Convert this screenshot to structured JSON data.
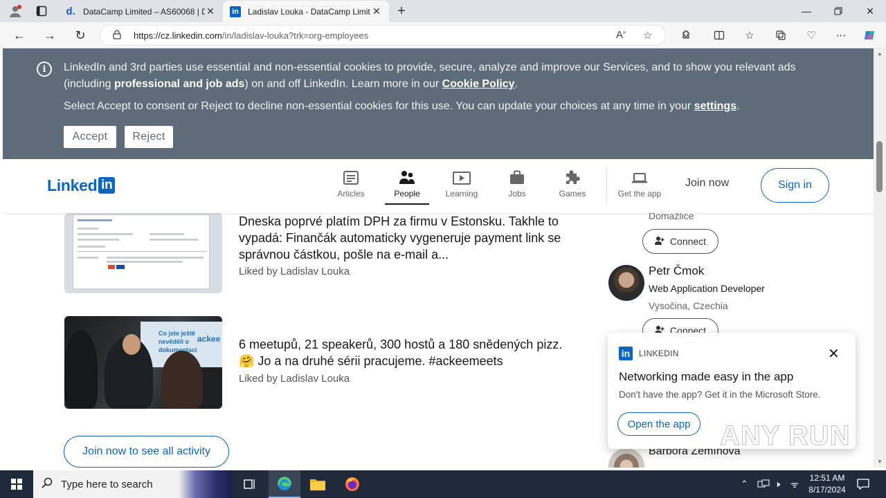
{
  "browser": {
    "tabs": [
      {
        "title": "DataCamp Limited – AS60068 | D",
        "favicon": "d."
      },
      {
        "title": "Ladislav Louka - DataCamp Limit",
        "favicon": "in"
      }
    ],
    "url_main": "https://cz.linkedin.com",
    "url_path": "/in/ladislav-louka?trk=org-employees"
  },
  "cookie_banner": {
    "line1_a": "LinkedIn and 3rd parties use essential and non-essential cookies to provide, secure, analyze and improve our Services, and to show you relevant ads (including ",
    "line1_bold": "professional and job ads",
    "line1_b": ") on and off LinkedIn. Learn more in our ",
    "cookie_policy": "Cookie Policy",
    "line1_c": ".",
    "line2_a": "Select Accept to consent or Reject to decline non-essential cookies for this use. You can update your choices at any time in your ",
    "settings": "settings",
    "line2_b": ".",
    "accept": "Accept",
    "reject": "Reject"
  },
  "nav": {
    "logo_text": "Linked",
    "logo_in": "in",
    "items": [
      {
        "label": "Articles"
      },
      {
        "label": "People"
      },
      {
        "label": "Learning"
      },
      {
        "label": "Jobs"
      },
      {
        "label": "Games"
      },
      {
        "label": "Get the app"
      }
    ],
    "join_now": "Join now",
    "sign_in": "Sign in"
  },
  "activity": [
    {
      "text": "Dneska poprvé platím DPH za firmu v Estonsku. Takhle to vypadá: Finančák automaticky vygeneruje payment link se správnou částkou, pošle na e-mail a...",
      "liked": "Liked by Ladislav Louka"
    },
    {
      "text": "6 meetupů, 21 speakerů, 300 hostů a 180 snědených pizz. 🤗 Jo a na druhé sérii pracujeme. #ackeemeets",
      "liked": "Liked by Ladislav Louka",
      "thumb_text_1": "Co jste ještě",
      "thumb_text_2": "nevěděli o",
      "thumb_text_3": "dokumentaci",
      "thumb_brand": "ackee"
    }
  ],
  "join_all": "Join now to see all activity",
  "people": {
    "p0_location": "Domažlice",
    "connect": "Connect",
    "p1_name": "Petr Čmok",
    "p1_title": "Web Application Developer",
    "p1_location": "Vysočina, Czechia",
    "p3_name": "Barbora Zemínová"
  },
  "app_popup": {
    "brand": "LINKEDIN",
    "heading": "Networking made easy in the app",
    "text": "Don't have the app? Get it in the Microsoft Store.",
    "button": "Open the app"
  },
  "watermark": "ANY RUN",
  "taskbar": {
    "search_placeholder": "Type here to search",
    "time": "12:51 AM",
    "date": "8/17/2024"
  }
}
